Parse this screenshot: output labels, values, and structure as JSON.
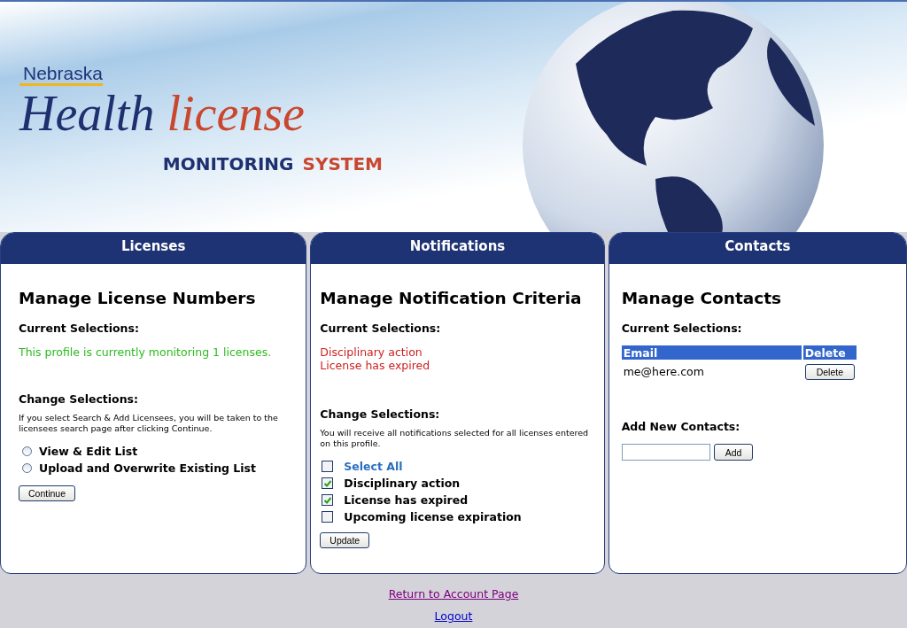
{
  "header": {
    "logo": {
      "state": "Nebraska",
      "title_1": "Health",
      "title_2": "license",
      "subtitle_1": "MONITORING",
      "subtitle_2": "SYSTEM"
    }
  },
  "panels": [
    {
      "kind": "licenses",
      "tab": "Licenses",
      "heading": "Manage License Numbers",
      "current_label": "Current Selections:",
      "status": "This profile is currently monitoring 1 licenses.",
      "change_label": "Change Selections:",
      "hint": "If you select Search & Add Licensees, you will be taken to the licensees search page after clicking Continue.",
      "options": [
        {
          "label": "View & Edit List",
          "selected": false
        },
        {
          "label": "Upload and Overwrite Existing List",
          "selected": false
        }
      ],
      "button": "Continue"
    },
    {
      "kind": "notifications",
      "tab": "Notifications",
      "heading": "Manage Notification Criteria",
      "current_label": "Current Selections:",
      "current_items": [
        "Disciplinary action",
        "License has expired"
      ],
      "change_label": "Change Selections:",
      "hint": "You will receive all notifications selected for all licenses entered on this profile.",
      "checkboxes": [
        {
          "kind": "select-all",
          "label": "Select All",
          "checked": false
        },
        {
          "kind": "criterion",
          "label": "Disciplinary action",
          "checked": true
        },
        {
          "kind": "criterion",
          "label": "License has expired",
          "checked": true
        },
        {
          "kind": "criterion",
          "label": "Upcoming license expiration",
          "checked": false
        }
      ],
      "button": "Update"
    },
    {
      "kind": "contacts",
      "tab": "Contacts",
      "heading": "Manage Contacts",
      "current_label": "Current Selections:",
      "table": {
        "columns": [
          "Email",
          "Delete"
        ],
        "rows": [
          {
            "email": "me@here.com",
            "action": "Delete"
          }
        ]
      },
      "add_label": "Add New Contacts:",
      "add_button": "Add"
    }
  ],
  "footer": {
    "links": [
      "Return to Account Page",
      "Logout"
    ]
  }
}
